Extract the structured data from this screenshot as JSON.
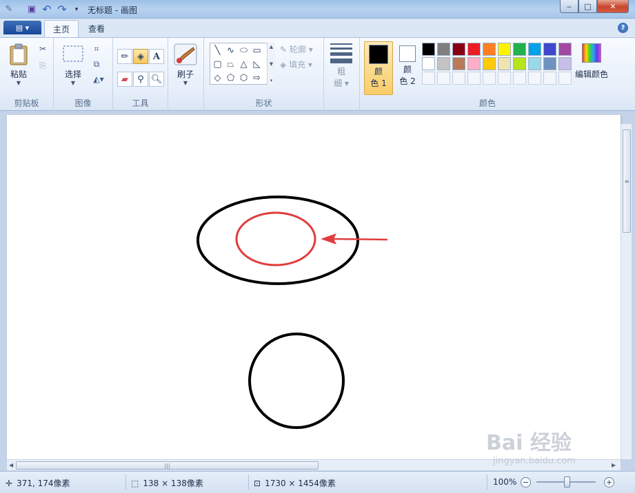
{
  "titlebar": {
    "title": "无标题 - 画图",
    "minimize": "‒",
    "maximize": "□",
    "close": "✕"
  },
  "tabs": {
    "app_menu": "▤ ▾",
    "home": "主页",
    "view": "查看",
    "help": "?"
  },
  "ribbon": {
    "clipboard": {
      "paste": "粘贴",
      "group": "剪贴板"
    },
    "image": {
      "select": "选择",
      "group": "图像"
    },
    "tools": {
      "group": "工具",
      "text_tool": "A"
    },
    "brushes": {
      "label": "刷子"
    },
    "shapes": {
      "group": "形状",
      "outline": "轮廓",
      "fill": "填充"
    },
    "size": {
      "label_top": "粗",
      "label_bottom": "细"
    },
    "colors": {
      "group": "颜色",
      "color1_label_a": "颜",
      "color1_label_b": "色 1",
      "color2_label_a": "颜",
      "color2_label_b": "色 2",
      "color1_value": "#000000",
      "color2_value": "#ffffff",
      "edit_colors": "编辑颜色",
      "palette_row1": [
        "#000000",
        "#7f7f7f",
        "#880015",
        "#ed1c24",
        "#ff7f27",
        "#fff200",
        "#22b14c",
        "#00a2e8",
        "#3f48cc",
        "#a349a4"
      ],
      "palette_row2": [
        "#ffffff",
        "#c3c3c3",
        "#b97a57",
        "#ffaec9",
        "#ffc90e",
        "#efe4b0",
        "#b5e61d",
        "#99d9ea",
        "#7092be",
        "#c8bfe7"
      ]
    }
  },
  "status": {
    "cursor_pos": "371, 174像素",
    "selection_size": "138 × 138像素",
    "canvas_size": "1730 × 1454像素",
    "zoom": "100%"
  },
  "watermark": {
    "main": "Bai 经验",
    "sub": "jingyan.baidu.com"
  }
}
